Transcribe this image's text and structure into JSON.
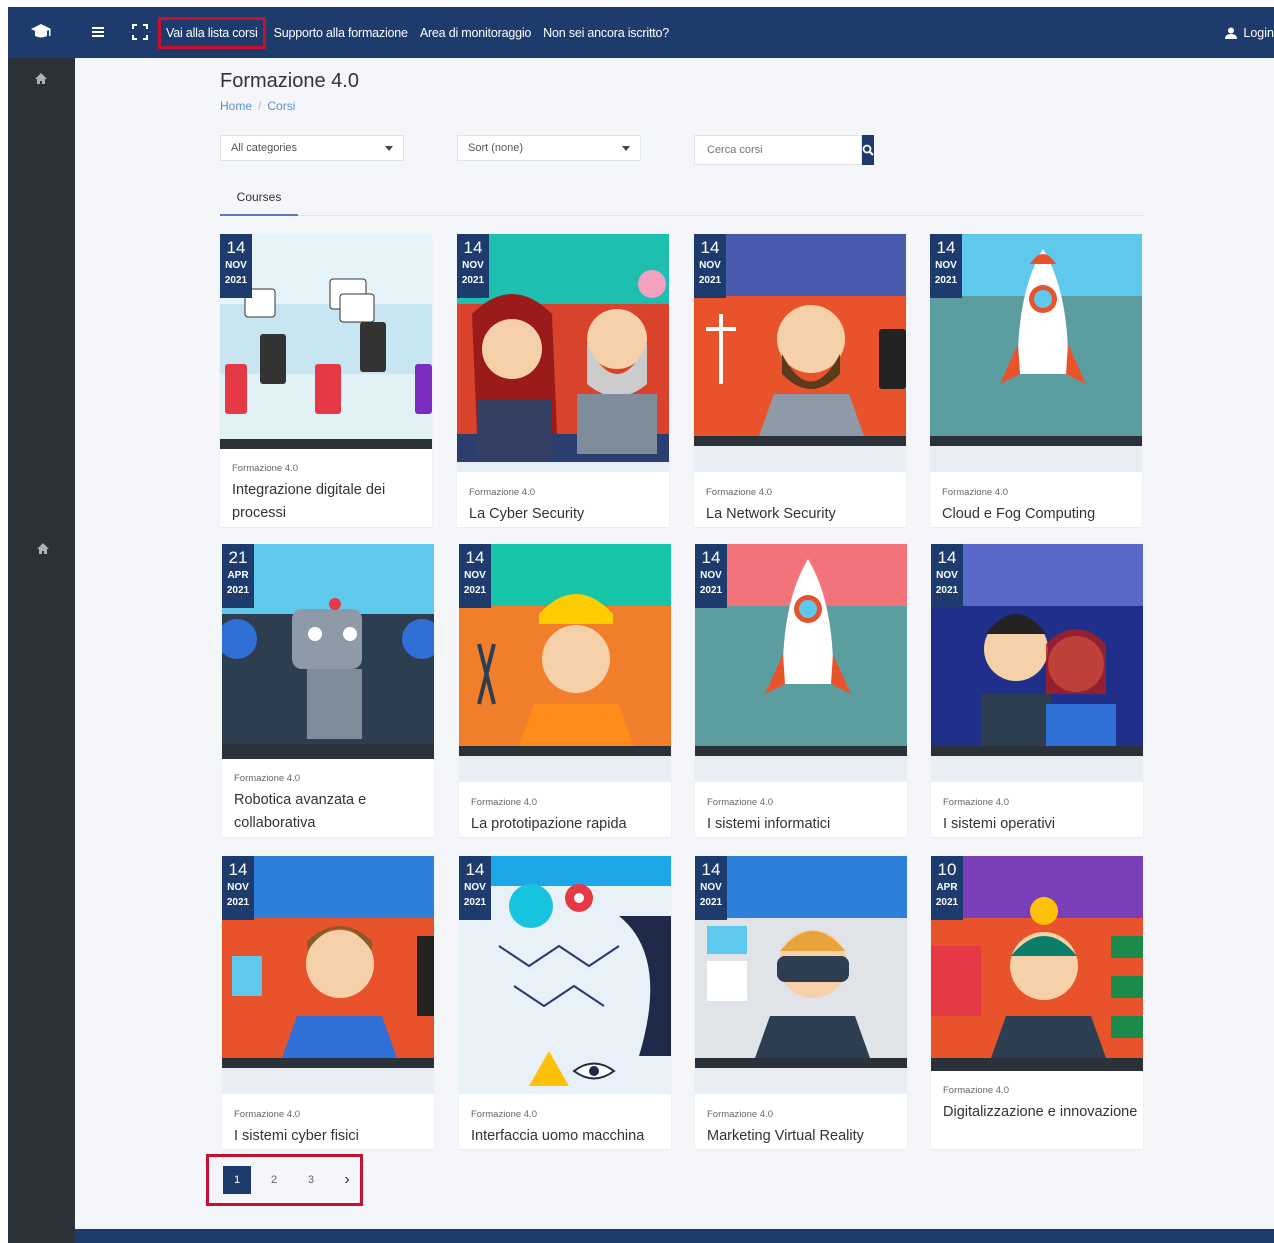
{
  "nav": {
    "links": [
      "Vai alla lista corsi",
      "Supporto alla formazione",
      "Area di monitoraggio",
      "Non sei ancora iscritto?"
    ],
    "login": "Login"
  },
  "page": {
    "title": "Formazione 4.0",
    "breadcrumb": [
      "Home",
      "Corsi"
    ]
  },
  "filters": {
    "category": "All categories",
    "sort": "Sort (none)",
    "search_placeholder": "Cerca corsi"
  },
  "tabs": [
    "Courses"
  ],
  "courses": [
    {
      "day": "14",
      "month": "NOV",
      "year": "2021",
      "category": "Formazione 4.0",
      "title": "Integrazione digitale dei processi"
    },
    {
      "day": "14",
      "month": "NOV",
      "year": "2021",
      "category": "Formazione 4.0",
      "title": "La Cyber Security"
    },
    {
      "day": "14",
      "month": "NOV",
      "year": "2021",
      "category": "Formazione 4.0",
      "title": "La Network Security"
    },
    {
      "day": "14",
      "month": "NOV",
      "year": "2021",
      "category": "Formazione 4.0",
      "title": "Cloud e Fog Computing"
    },
    {
      "day": "21",
      "month": "APR",
      "year": "2021",
      "category": "Formazione 4.0",
      "title": "Robotica avanzata e collaborativa"
    },
    {
      "day": "14",
      "month": "NOV",
      "year": "2021",
      "category": "Formazione 4.0",
      "title": "La prototipazione rapida"
    },
    {
      "day": "14",
      "month": "NOV",
      "year": "2021",
      "category": "Formazione 4.0",
      "title": "I sistemi informatici"
    },
    {
      "day": "14",
      "month": "NOV",
      "year": "2021",
      "category": "Formazione 4.0",
      "title": "I sistemi operativi"
    },
    {
      "day": "14",
      "month": "NOV",
      "year": "2021",
      "category": "Formazione 4.0",
      "title": "I sistemi cyber fisici"
    },
    {
      "day": "14",
      "month": "NOV",
      "year": "2021",
      "category": "Formazione 4.0",
      "title": "Interfaccia uomo macchina"
    },
    {
      "day": "14",
      "month": "NOV",
      "year": "2021",
      "category": "Formazione 4.0",
      "title": "Marketing Virtual Reality"
    },
    {
      "day": "10",
      "month": "APR",
      "year": "2021",
      "category": "Formazione 4.0",
      "title": "Digitalizzazione e innovazione"
    }
  ],
  "pagination": {
    "pages": [
      "1",
      "2",
      "3"
    ],
    "next": "›",
    "active": "1"
  },
  "colors": {
    "brand": "#1e3b6e",
    "sidebar": "#2a3138",
    "highlight": "#c8102e"
  }
}
